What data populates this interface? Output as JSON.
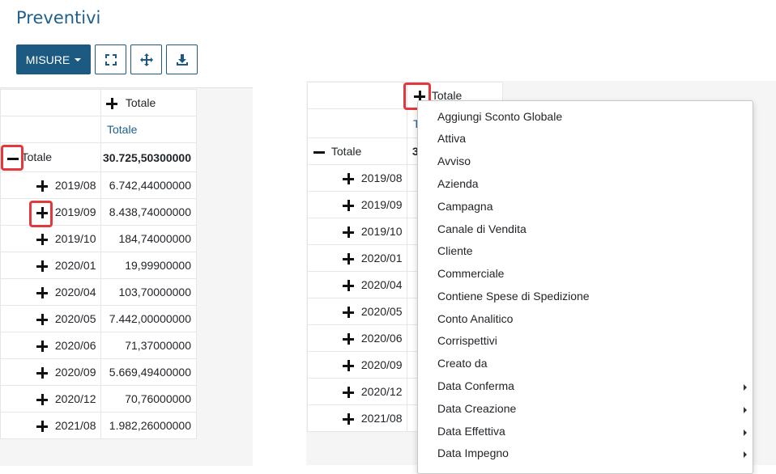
{
  "page": {
    "title": "Preventivi"
  },
  "toolbar": {
    "measures_label": "MISURE",
    "icons": [
      "expand-icon",
      "move-arrows-icon",
      "download-icon"
    ]
  },
  "left_pivot": {
    "col_header": "Totale",
    "measure": "Totale",
    "total_row": {
      "label": "Totale",
      "value": "30.725,50300000"
    },
    "rows": [
      {
        "label": "2019/08",
        "value": "6.742,44000000"
      },
      {
        "label": "2019/09",
        "value": "8.438,74000000"
      },
      {
        "label": "2019/10",
        "value": "184,74000000"
      },
      {
        "label": "2020/01",
        "value": "19,99900000"
      },
      {
        "label": "2020/04",
        "value": "103,70000000"
      },
      {
        "label": "2020/05",
        "value": "7.442,00000000"
      },
      {
        "label": "2020/06",
        "value": "71,37000000"
      },
      {
        "label": "2020/09",
        "value": "5.669,49400000"
      },
      {
        "label": "2020/12",
        "value": "70,76000000"
      },
      {
        "label": "2021/08",
        "value": "1.982,26000000"
      }
    ]
  },
  "right_pivot": {
    "col_header": "Totale",
    "measure_partial": "To",
    "total_row": {
      "label": "Totale",
      "value_partial": "30"
    },
    "rows": [
      "2019/08",
      "2019/09",
      "2019/10",
      "2020/01",
      "2020/04",
      "2020/05",
      "2020/06",
      "2020/09",
      "2020/12",
      "2021/08"
    ]
  },
  "dropdown": {
    "items": [
      {
        "label": "Aggiungi Sconto Globale"
      },
      {
        "label": "Attiva"
      },
      {
        "label": "Avviso"
      },
      {
        "label": "Azienda"
      },
      {
        "label": "Campagna"
      },
      {
        "label": "Canale di Vendita"
      },
      {
        "label": "Cliente"
      },
      {
        "label": "Commerciale"
      },
      {
        "label": "Contiene Spese di Spedizione"
      },
      {
        "label": "Conto Analitico"
      },
      {
        "label": "Corrispettivi"
      },
      {
        "label": "Creato da"
      },
      {
        "label": "Data Conferma"
      },
      {
        "label": "Data Creazione"
      },
      {
        "label": "Data Effettiva"
      },
      {
        "label": "Data Impegno"
      }
    ]
  },
  "colors": {
    "primary": "#1d5a82",
    "title": "#1f5f8b",
    "highlight": "#e4393c"
  }
}
